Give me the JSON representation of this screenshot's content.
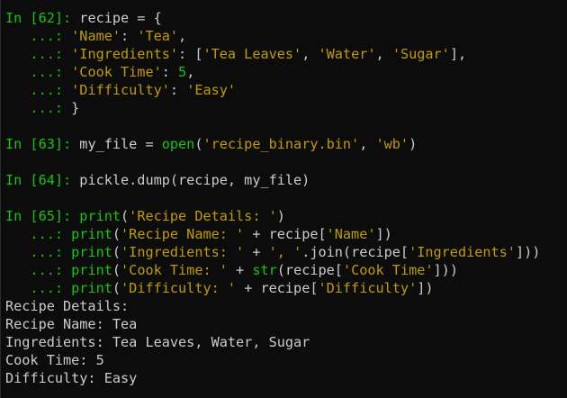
{
  "theme": {
    "background": "#0c0c0c",
    "text": "#cccccc",
    "prompt": "#16c60c",
    "string": "#c19c00",
    "number": "#16c60c",
    "builtin": "#16c60c"
  },
  "lines": [
    [
      {
        "t": "prompt-in",
        "v": "In [62]: "
      },
      {
        "t": "plain",
        "v": "recipe = {"
      }
    ],
    [
      {
        "t": "prompt-cont",
        "v": "   ...: "
      },
      {
        "t": "string",
        "v": "'Name'"
      },
      {
        "t": "plain",
        "v": ": "
      },
      {
        "t": "string",
        "v": "'Tea'"
      },
      {
        "t": "plain",
        "v": ","
      }
    ],
    [
      {
        "t": "prompt-cont",
        "v": "   ...: "
      },
      {
        "t": "string",
        "v": "'Ingredients'"
      },
      {
        "t": "plain",
        "v": ": ["
      },
      {
        "t": "string",
        "v": "'Tea Leaves'"
      },
      {
        "t": "plain",
        "v": ", "
      },
      {
        "t": "string",
        "v": "'Water'"
      },
      {
        "t": "plain",
        "v": ", "
      },
      {
        "t": "string",
        "v": "'Sugar'"
      },
      {
        "t": "plain",
        "v": "],"
      }
    ],
    [
      {
        "t": "prompt-cont",
        "v": "   ...: "
      },
      {
        "t": "string",
        "v": "'Cook Time'"
      },
      {
        "t": "plain",
        "v": ": "
      },
      {
        "t": "number",
        "v": "5"
      },
      {
        "t": "plain",
        "v": ","
      }
    ],
    [
      {
        "t": "prompt-cont",
        "v": "   ...: "
      },
      {
        "t": "string",
        "v": "'Difficulty'"
      },
      {
        "t": "plain",
        "v": ": "
      },
      {
        "t": "string",
        "v": "'Easy'"
      }
    ],
    [
      {
        "t": "prompt-cont",
        "v": "   ...: "
      },
      {
        "t": "plain",
        "v": "}"
      }
    ],
    [],
    [
      {
        "t": "prompt-in",
        "v": "In [63]: "
      },
      {
        "t": "plain",
        "v": "my_file = "
      },
      {
        "t": "builtin",
        "v": "open"
      },
      {
        "t": "plain",
        "v": "("
      },
      {
        "t": "string",
        "v": "'recipe_binary.bin'"
      },
      {
        "t": "plain",
        "v": ", "
      },
      {
        "t": "string",
        "v": "'wb'"
      },
      {
        "t": "plain",
        "v": ")"
      }
    ],
    [],
    [
      {
        "t": "prompt-in",
        "v": "In [64]: "
      },
      {
        "t": "plain",
        "v": "pickle.dump(recipe, my_file)"
      }
    ],
    [],
    [
      {
        "t": "prompt-in",
        "v": "In [65]: "
      },
      {
        "t": "builtin",
        "v": "print"
      },
      {
        "t": "plain",
        "v": "("
      },
      {
        "t": "string",
        "v": "'Recipe Details: '"
      },
      {
        "t": "plain",
        "v": ")"
      }
    ],
    [
      {
        "t": "prompt-cont",
        "v": "   ...: "
      },
      {
        "t": "builtin",
        "v": "print"
      },
      {
        "t": "plain",
        "v": "("
      },
      {
        "t": "string",
        "v": "'Recipe Name: '"
      },
      {
        "t": "plain",
        "v": " + recipe["
      },
      {
        "t": "string",
        "v": "'Name'"
      },
      {
        "t": "plain",
        "v": "])"
      }
    ],
    [
      {
        "t": "prompt-cont",
        "v": "   ...: "
      },
      {
        "t": "builtin",
        "v": "print"
      },
      {
        "t": "plain",
        "v": "("
      },
      {
        "t": "string",
        "v": "'Ingredients: '"
      },
      {
        "t": "plain",
        "v": " + "
      },
      {
        "t": "string",
        "v": "', '"
      },
      {
        "t": "plain",
        "v": ".join(recipe["
      },
      {
        "t": "string",
        "v": "'Ingredients'"
      },
      {
        "t": "plain",
        "v": "]))"
      }
    ],
    [
      {
        "t": "prompt-cont",
        "v": "   ...: "
      },
      {
        "t": "builtin",
        "v": "print"
      },
      {
        "t": "plain",
        "v": "("
      },
      {
        "t": "string",
        "v": "'Cook Time: '"
      },
      {
        "t": "plain",
        "v": " + "
      },
      {
        "t": "builtin",
        "v": "str"
      },
      {
        "t": "plain",
        "v": "(recipe["
      },
      {
        "t": "string",
        "v": "'Cook Time'"
      },
      {
        "t": "plain",
        "v": "]))"
      }
    ],
    [
      {
        "t": "prompt-cont",
        "v": "   ...: "
      },
      {
        "t": "builtin",
        "v": "print"
      },
      {
        "t": "plain",
        "v": "("
      },
      {
        "t": "string",
        "v": "'Difficulty: '"
      },
      {
        "t": "plain",
        "v": " + recipe["
      },
      {
        "t": "string",
        "v": "'Difficulty'"
      },
      {
        "t": "plain",
        "v": "])"
      }
    ],
    [
      {
        "t": "output",
        "v": "Recipe Details:"
      }
    ],
    [
      {
        "t": "output",
        "v": "Recipe Name: Tea"
      }
    ],
    [
      {
        "t": "output",
        "v": "Ingredients: Tea Leaves, Water, Sugar"
      }
    ],
    [
      {
        "t": "output",
        "v": "Cook Time: 5"
      }
    ],
    [
      {
        "t": "output",
        "v": "Difficulty: Easy"
      }
    ]
  ]
}
